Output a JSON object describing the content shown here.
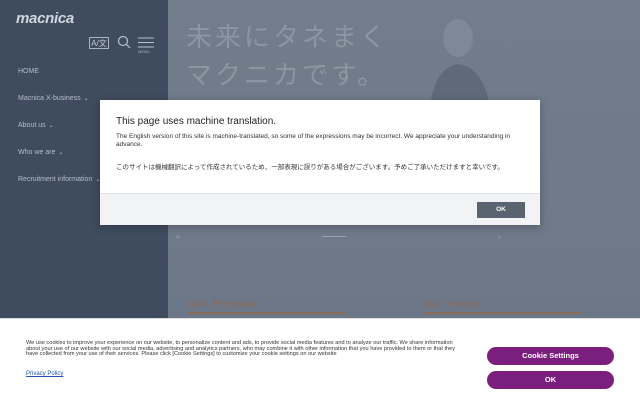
{
  "sidebar": {
    "logo": "macnica",
    "lang_label": "A/文",
    "menu_label": "MENU",
    "nav": [
      {
        "label": "HOME",
        "has_chevron": false
      },
      {
        "label": "Macnica X-business",
        "has_chevron": true
      },
      {
        "label": "About us",
        "has_chevron": true
      },
      {
        "label": "Who we are",
        "has_chevron": true
      },
      {
        "label": "Recruitment information",
        "has_chevron": true
      }
    ]
  },
  "hero": {
    "headline_line1": "未来にタネまく",
    "headline_line2": "マクニカです。",
    "mark_left": "«",
    "mark_right": "›"
  },
  "sections": {
    "purpose": "Our Purpose",
    "voice": "Our Voice"
  },
  "modal": {
    "title": "This page uses machine translation.",
    "body_en": "The English version of this site is machine-translated, so some of the expressions may be incorrect. We appreciate your understanding in advance.",
    "body_jp": "このサイトは機械翻訳によって作成されているため、一部表現に誤りがある場合がございます。予めご了承いただけますと幸いです。",
    "ok_label": "OK"
  },
  "cookie": {
    "text": "We use cookies to improve your experience on our website, to personalize content and ads, to provide social media features and to analyze our traffic. We share information about your use of our website with our social media, advertising and analytics partners, who may combine it with other information that you have provided to them or that they have collected from your use of their services. Please click [Cookie Settings] to customize your cookie settings on our website",
    "privacy_label": "Privacy Policy",
    "settings_label": "Cookie Settings",
    "ok_label": "OK"
  },
  "colors": {
    "accent": "#7b1f7e",
    "sidebar_bg": "#3f4b5e",
    "section_brown": "#8a6b5a"
  }
}
